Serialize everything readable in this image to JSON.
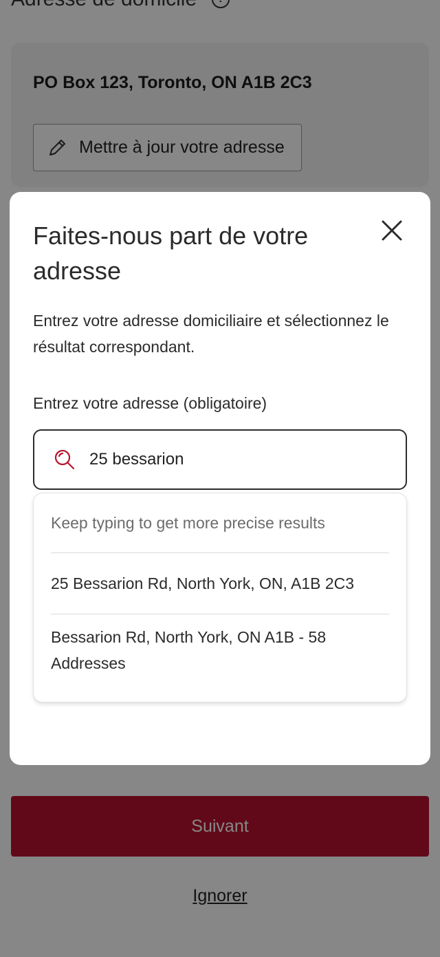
{
  "page": {
    "section_title": "Adresse de domicile",
    "current_address": "PO Box 123, Toronto, ON A1B 2C3",
    "update_button": "Mettre à jour votre adresse",
    "next_button": "Suivant",
    "ignore_link": "Ignorer"
  },
  "modal": {
    "title": "Faites-nous part de votre adresse",
    "description": "Entrez votre adresse domiciliaire et sélectionnez le résultat correspondant.",
    "field_label": "Entrez votre adresse (obligatoire)",
    "search_value": "25 bessarion",
    "results": {
      "hint": "Keep typing to get more precise results",
      "items": [
        {
          "label": "25 Bessarion Rd, North York, ON, A1B 2C3"
        },
        {
          "label": "Bessarion Rd, North York, ON A1B - 58 Addresses"
        }
      ]
    }
  },
  "icons": {
    "info": "info-icon",
    "pencil": "pencil-icon",
    "close": "close-icon",
    "search": "search-icon"
  },
  "colors": {
    "accent": "#b7122e",
    "scrim": "rgba(0,0,0,0.47)",
    "text": "#2b2b2b"
  }
}
